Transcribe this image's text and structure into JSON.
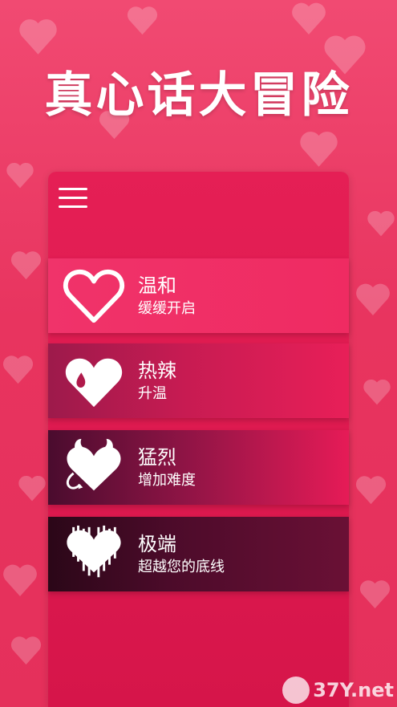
{
  "app": {
    "title": "真心话大冒险"
  },
  "menu": {
    "icon": "hamburger-menu-icon"
  },
  "options": [
    {
      "title": "温和",
      "subtitle": "缓缓开启",
      "icon": "outline-heart-icon"
    },
    {
      "title": "热辣",
      "subtitle": "升温",
      "icon": "drop-heart-icon"
    },
    {
      "title": "猛烈",
      "subtitle": "增加难度",
      "icon": "devil-heart-icon"
    },
    {
      "title": "极端",
      "subtitle": "超越您的底线",
      "icon": "dripping-heart-icon"
    }
  ],
  "watermark": {
    "text": "37Y.net"
  },
  "colors": {
    "background": "#e8345f",
    "panel": "#d6154a",
    "accent": "#ffffff"
  }
}
